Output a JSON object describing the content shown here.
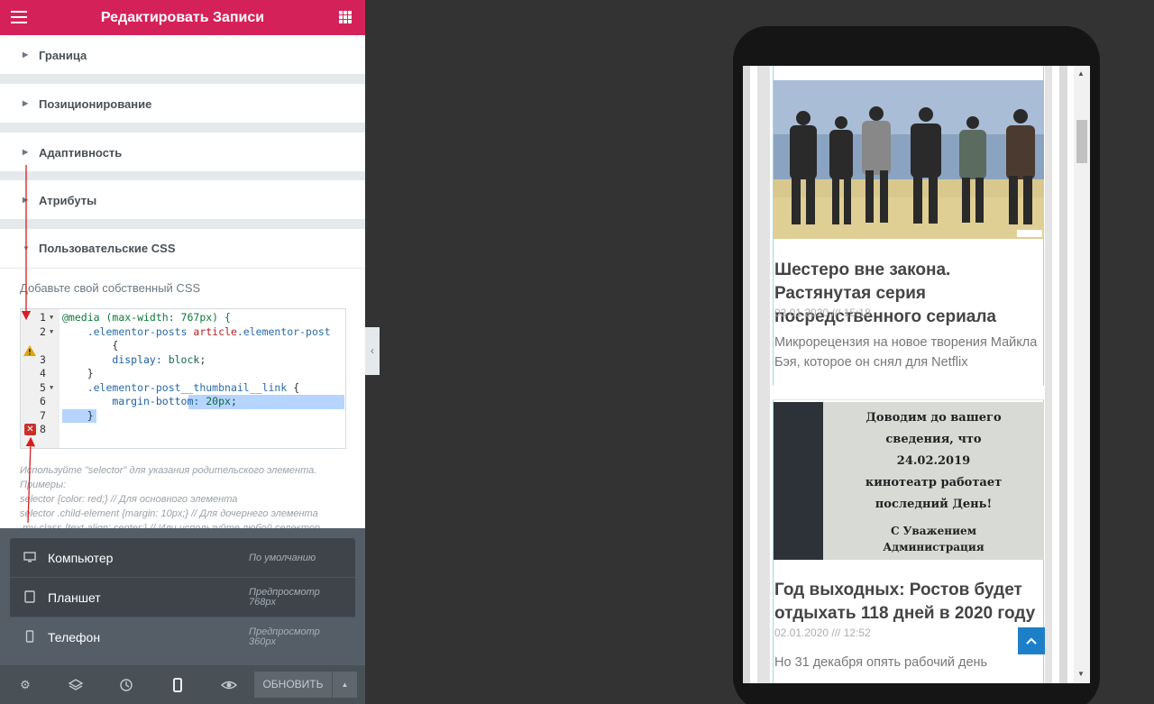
{
  "header": {
    "title": "Редактировать Записи"
  },
  "sections": {
    "border": "Граница",
    "positioning": "Позиционирование",
    "responsive": "Адаптивность",
    "attributes": "Атрибуты",
    "custom_css": "Пользовательские CSS"
  },
  "custom_css": {
    "hint": "Добавьте свой собственный CSS",
    "code": {
      "l1_a": "@media",
      "l1_b": " (max-width: 767px) {",
      "l2_a": "    ",
      "l2_b": ".elementor-posts",
      "l2_c": " article",
      "l2_d": ".elementor-post",
      "l2b": "        {",
      "l3_a": "        display: ",
      "l3_b": "block",
      "l3_c": ";",
      "l4": "    }",
      "l5_a": "    ",
      "l5_b": ".elementor-post__thumbnail__link",
      "l5_c": " {",
      "l6_a": "        margin-bottom: ",
      "l6_b": "20px",
      "l6_c": ";",
      "l7": "    }",
      "l8": ""
    },
    "line_numbers": [
      "1",
      "2",
      "3",
      "4",
      "5",
      "6",
      "7",
      "8"
    ],
    "help": [
      "Используйте \"selector\" для указания родительского элемента.",
      "Примеры:",
      "selector {color: red;} // Для основного элемента",
      "selector .child-element {margin: 10px;} // Для дочернего элемента",
      ".my-class {text-align: center;} // Или используйте любой селектор"
    ]
  },
  "responsive_menu": {
    "items": [
      {
        "label": "Компьютер",
        "hint": "По умолчанию",
        "icon": "desktop-icon"
      },
      {
        "label": "Планшет",
        "hint": "Предпросмотр 768px",
        "icon": "tablet-icon"
      },
      {
        "label": "Телефон",
        "hint": "Предпросмотр 360px",
        "icon": "mobile-icon"
      }
    ],
    "active": "Телефон"
  },
  "footer": {
    "update_label": "ОБНОВИТЬ",
    "icons": [
      "gear-icon",
      "layers-icon",
      "history-icon",
      "mobile-icon",
      "eye-icon"
    ]
  },
  "preview": {
    "posts": [
      {
        "title": "Шестеро вне закона. Растянутая серия посредственного сериала",
        "meta": "03.01.2020 /// 15:18",
        "excerpt": "Микрорецензия на новое творения Майкла Бэя, которое он снял для Netflix"
      },
      {
        "title": "Год выходных: Ростов будет отдыхать 118 дней в 2020 году",
        "meta": "02.01.2020 /// 12:52",
        "excerpt": "Но 31 декабря опять рабочий день"
      }
    ],
    "notice_lines": [
      "Доводим до вашего",
      "сведения, что",
      "24.02.2019",
      "кинотеатр работает",
      "последний День!",
      "С Уважением",
      "Администрация"
    ]
  },
  "colors": {
    "brand": "#d5215a",
    "panel_dark": "#495157",
    "accent_blue": "#1e7fc9"
  }
}
